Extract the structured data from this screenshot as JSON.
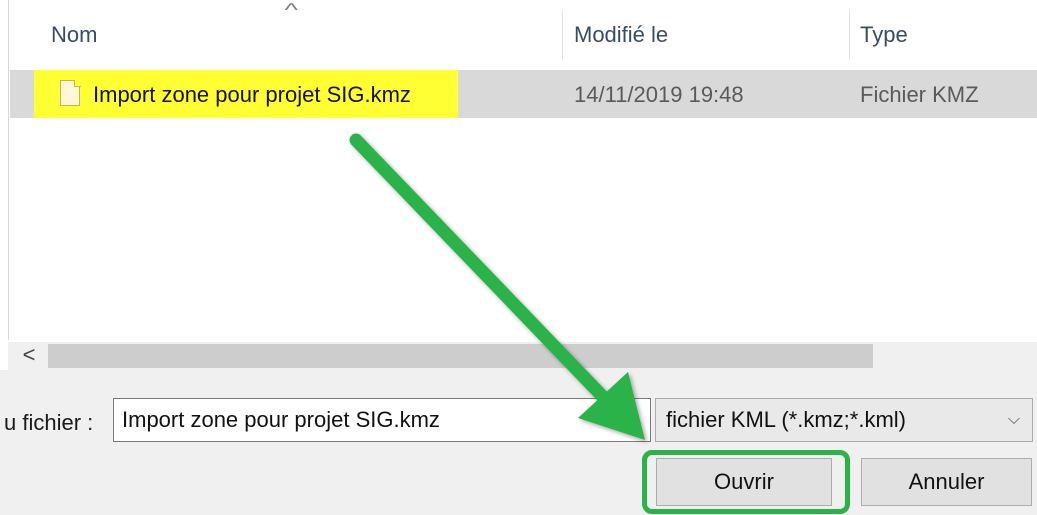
{
  "columns": {
    "name": "Nom",
    "modified": "Modifié le",
    "type": "Type"
  },
  "file_row": {
    "name": "Import zone pour projet SIG.kmz",
    "modified": "14/11/2019 19:48",
    "type": "Fichier KMZ"
  },
  "scrollbar": {
    "left_arrow": "<"
  },
  "filename": {
    "label": "u fichier :",
    "value": "Import zone pour projet SIG.kmz"
  },
  "file_type": {
    "selected": "fichier KML (*.kmz;*.kml)",
    "chevron": "⌵"
  },
  "buttons": {
    "open": "Ouvrir",
    "cancel": "Annuler"
  },
  "annotations": {
    "highlight_color": "#ffff33",
    "arrow_color": "#2bb34a"
  }
}
